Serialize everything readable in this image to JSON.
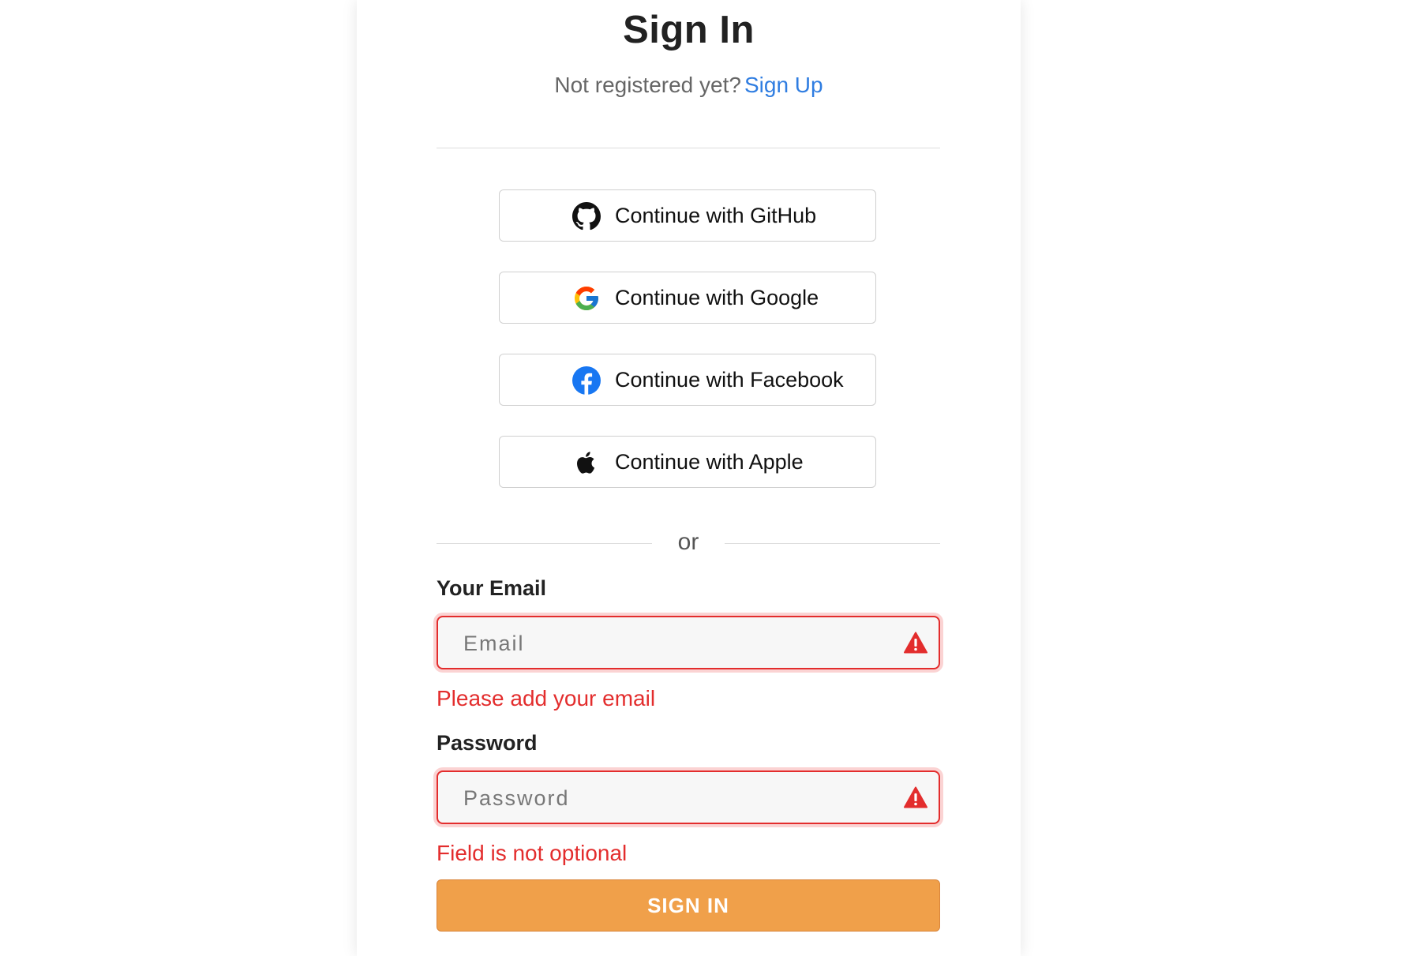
{
  "header": {
    "title": "Sign In",
    "subtitle_text": "Not registered yet?",
    "signup_link": "Sign Up"
  },
  "social": [
    {
      "label": "Continue with GitHub",
      "icon": "github-icon"
    },
    {
      "label": "Continue with Google",
      "icon": "google-icon"
    },
    {
      "label": "Continue with Facebook",
      "icon": "facebook-icon"
    },
    {
      "label": "Continue with Apple",
      "icon": "apple-icon"
    }
  ],
  "divider": {
    "text": "or"
  },
  "form": {
    "email": {
      "label": "Your Email",
      "placeholder": "Email",
      "value": "",
      "error": "Please add your email"
    },
    "password": {
      "label": "Password",
      "placeholder": "Password",
      "value": "",
      "error": "Field is not optional"
    },
    "submit_label": "SIGN IN"
  },
  "colors": {
    "accent": "#f0a04a",
    "link": "#2f7de1",
    "error": "#e32d2d"
  }
}
